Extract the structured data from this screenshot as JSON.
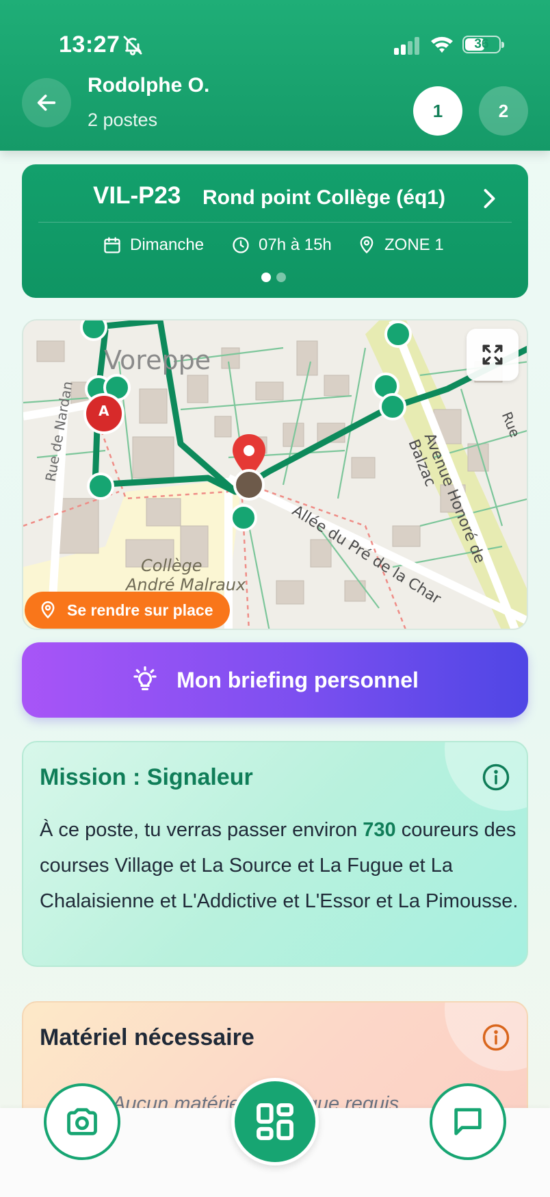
{
  "status_bar": {
    "time": "13:27",
    "battery": "36"
  },
  "header": {
    "name": "Rodolphe O.",
    "subtitle": "2 postes",
    "steps": [
      "1",
      "2"
    ]
  },
  "post": {
    "code": "VIL-P23",
    "name": "Rond point Collège (éq1)",
    "day": "Dimanche",
    "time": "07h à 15h",
    "zone": "ZONE 1"
  },
  "map": {
    "labels": [
      "Voreppe",
      "Rue de Nardan",
      "Collège",
      "André Malraux",
      "Allée du Pré de la Char",
      "Avenue Honoré de Balzac",
      "Rue"
    ],
    "start_marker": "A",
    "goto_label": "Se rendre sur place"
  },
  "briefing": {
    "label": "Mon briefing personnel"
  },
  "mission": {
    "title": "Mission : Signaleur",
    "text_before": "À ce poste, tu verras passer environ ",
    "count": "730",
    "text_after": " coureurs des courses Village et La Source et La Fugue et La Chalaisienne et L'Addictive et L'Essor et La Pimousse."
  },
  "materiel": {
    "title": "Matériel nécessaire",
    "text": "Aucun matériel spécifique requis"
  },
  "colors": {
    "primary": "#17a572",
    "orange": "#f9761a",
    "purple_start": "#a855f7",
    "purple_end": "#4f46e5"
  },
  "icons": [
    "back-arrow-icon",
    "bell-off-icon",
    "calendar-icon",
    "clock-icon",
    "location-pin-icon",
    "chevron-right-icon",
    "expand-icon",
    "lightbulb-icon",
    "info-icon",
    "camera-icon",
    "grid-icon",
    "chat-icon"
  ]
}
